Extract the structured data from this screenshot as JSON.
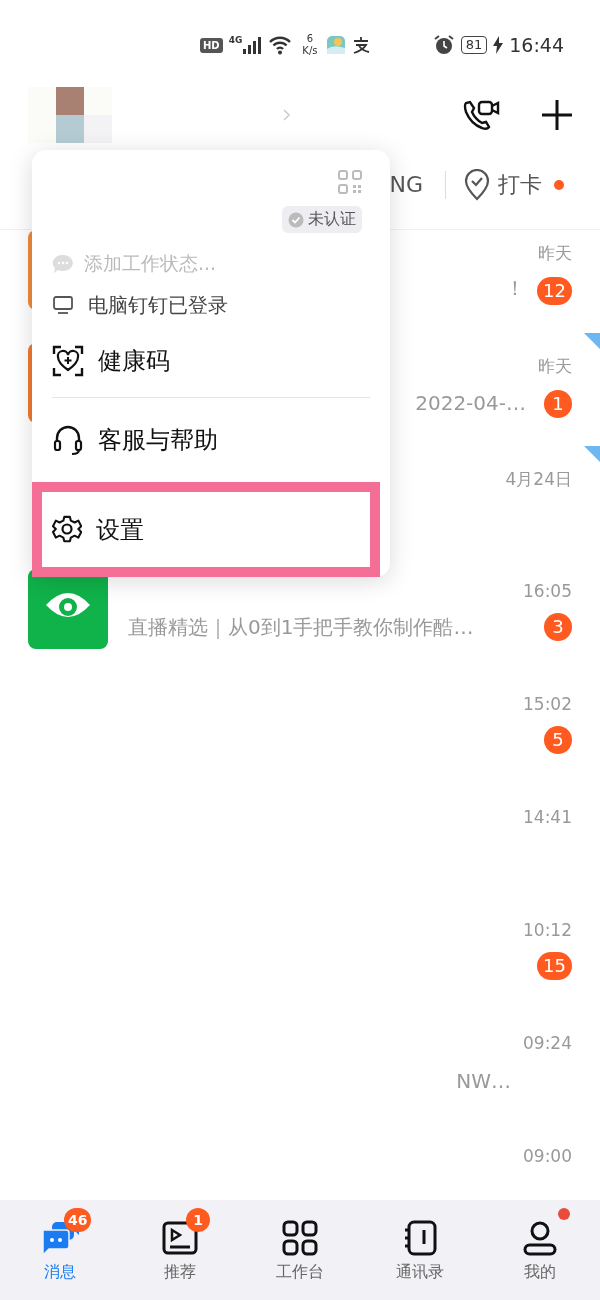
{
  "status_bar": {
    "hd": "HD",
    "network": "4G",
    "speed_value": "6",
    "speed_unit": "K/s",
    "battery": "81",
    "time": "16:44"
  },
  "tab_row": {
    "partial_label": "NG",
    "checkin": {
      "label": "打卡",
      "dot": true
    }
  },
  "popup": {
    "verification": "未认证",
    "status_placeholder": "添加工作状态...",
    "items": [
      {
        "kind": "desktop",
        "label": "电脑钉钉已登录",
        "highlighted": false
      },
      {
        "kind": "health",
        "label": "健康码",
        "highlighted": false
      },
      {
        "kind": "help",
        "label": "客服与帮助",
        "highlighted": false
      },
      {
        "kind": "settings",
        "label": "设置",
        "highlighted": true
      }
    ]
  },
  "messages": [
    {
      "time": "昨天",
      "preview": "！",
      "obscured": true,
      "badge": "12",
      "pinned": false,
      "color": "#f08a3c"
    },
    {
      "time": "昨天",
      "preview": "2022-04-…",
      "obscured": true,
      "badge": "1",
      "pinned": true,
      "color": "#f07a30"
    },
    {
      "time": "4月24日",
      "pinned": true
    },
    {
      "time": "16:05",
      "preview": "直播精选｜从0到1手把手教你制作酷…",
      "obscured": false,
      "badge": "3",
      "pinned": false,
      "color": "#10b24a"
    },
    {
      "time": "15:02",
      "badge": "5",
      "pinned": false
    },
    {
      "time": "14:41",
      "pinned": false
    },
    {
      "time": "10:12",
      "badge": "15",
      "pinned": false
    },
    {
      "time": "09:24",
      "preview": "NW…",
      "obscured": true,
      "pinned": false
    },
    {
      "time": "09:00",
      "pinned": false
    }
  ],
  "nav": [
    {
      "kind": "messages",
      "label": "消息",
      "selected": true,
      "badge": "46",
      "dot": false
    },
    {
      "kind": "feed",
      "label": "推荐",
      "selected": false,
      "badge": "1",
      "dot": false
    },
    {
      "kind": "workbench",
      "label": "工作台",
      "selected": false,
      "dot": false
    },
    {
      "kind": "contacts",
      "label": "通讯录",
      "selected": false,
      "dot": false
    },
    {
      "kind": "me",
      "label": "我的",
      "selected": false,
      "dot": true
    }
  ]
}
